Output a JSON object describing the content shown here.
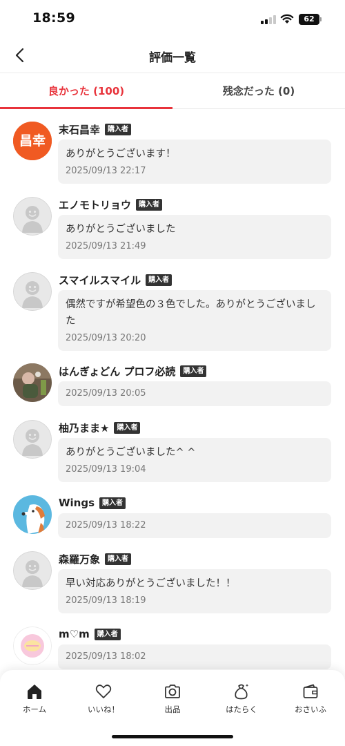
{
  "status_bar": {
    "time": "18:59",
    "battery": "62"
  },
  "header": {
    "title": "評価一覧"
  },
  "tabs": [
    {
      "label": "良かった (100)",
      "active": true
    },
    {
      "label": "残念だった (0)",
      "active": false
    }
  ],
  "buyer_badge": "購入者",
  "reviews": [
    {
      "name": "末石昌幸",
      "avatar_text": "昌幸",
      "avatar_color": "#f05a22",
      "comment": "ありがとうございます！",
      "date": "2025/09/13 22:17"
    },
    {
      "name": "エノモトリョウ",
      "comment": "ありがとうございました",
      "date": "2025/09/13 21:49"
    },
    {
      "name": "スマイルスマイル",
      "comment": "偶然ですが希望色の３色でした。ありがとうございました",
      "date": "2025/09/13 20:20"
    },
    {
      "name": "はんぎょどん プロフ必読",
      "comment": "",
      "date": "2025/09/13 20:05"
    },
    {
      "name": "柚乃まま★",
      "comment": "ありがとうございました^ ^",
      "date": "2025/09/13 19:04"
    },
    {
      "name": "Wings",
      "comment": "",
      "date": "2025/09/13 18:22"
    },
    {
      "name": "森羅万象",
      "comment": "早い対応ありがとうございました！！",
      "date": "2025/09/13 18:19"
    },
    {
      "name": "m♡m",
      "comment": "",
      "date": "2025/09/13 18:02"
    }
  ],
  "bottom_nav": [
    {
      "label": "ホーム",
      "icon": "home-icon"
    },
    {
      "label": "いいね！",
      "icon": "heart-icon"
    },
    {
      "label": "出品",
      "icon": "camera-icon"
    },
    {
      "label": "はたらく",
      "icon": "money-bag-icon"
    },
    {
      "label": "おさいふ",
      "icon": "wallet-icon"
    }
  ],
  "colors": {
    "accent": "#e8333b",
    "badge": "#333333",
    "bubble": "#f2f2f2"
  }
}
